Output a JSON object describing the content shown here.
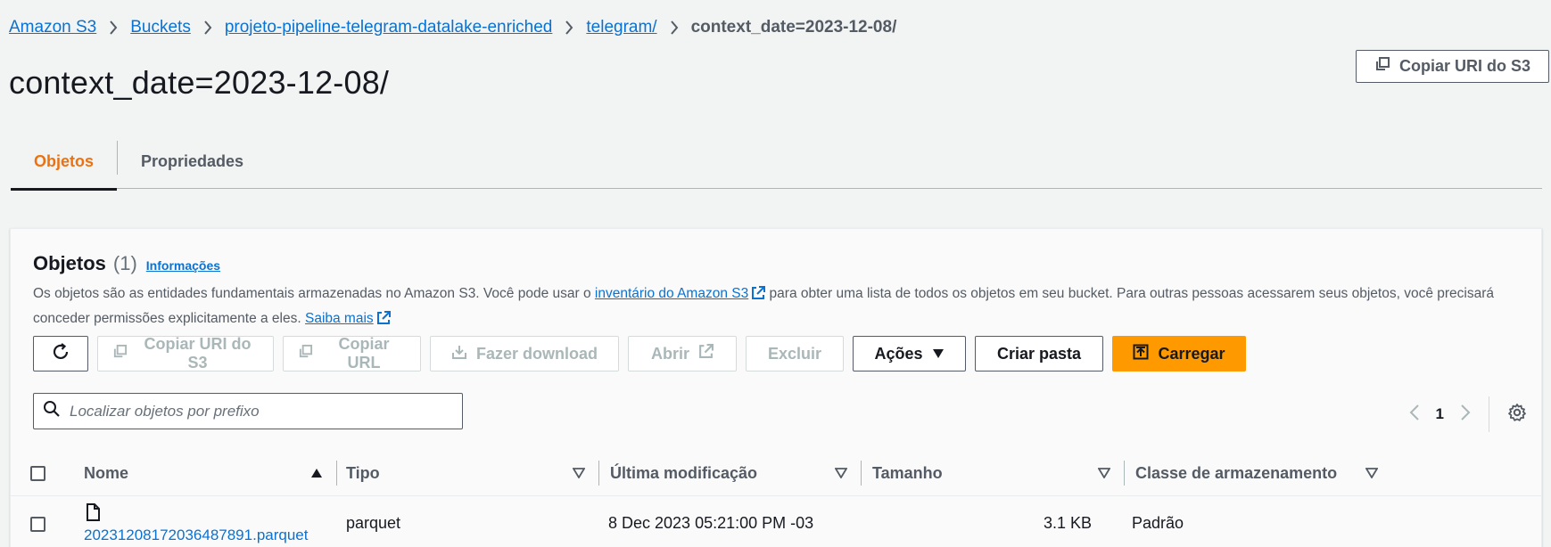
{
  "breadcrumb": {
    "items": [
      "Amazon S3",
      "Buckets",
      "projeto-pipeline-telegram-datalake-enriched",
      "telegram/"
    ],
    "current": "context_date=2023-12-08/"
  },
  "page": {
    "title": "context_date=2023-12-08/",
    "copy_uri_label": "Copiar URI do S3"
  },
  "tabs": [
    {
      "label": "Objetos",
      "active": true
    },
    {
      "label": "Propriedades",
      "active": false
    }
  ],
  "objects_panel": {
    "title": "Objetos",
    "count": "(1)",
    "info_link": "Informações",
    "desc_part1": "Os objetos são as entidades fundamentais armazenadas no Amazon S3. Você pode usar o ",
    "desc_link1": "inventário do Amazon S3",
    "desc_part2": " para obter uma lista de todos os objetos em seu bucket. Para outras pessoas acessarem seus objetos, você precisará conceder permissões explicitamente a eles. ",
    "desc_link2": "Saiba mais"
  },
  "toolbar": {
    "refresh_icon": "refresh-icon",
    "copy_uri": "Copiar URI do S3",
    "copy_url": "Copiar URL",
    "download": "Fazer download",
    "open": "Abrir",
    "delete": "Excluir",
    "actions": "Ações",
    "create_folder": "Criar pasta",
    "upload": "Carregar"
  },
  "search": {
    "placeholder": "Localizar objetos por prefixo",
    "value": ""
  },
  "pagination": {
    "current_page": "1"
  },
  "table": {
    "columns": [
      "Nome",
      "Tipo",
      "Última modificação",
      "Tamanho",
      "Classe de armazenamento"
    ],
    "rows": [
      {
        "name": "20231208172036487891.parquet",
        "type": "parquet",
        "modified": "8 Dec 2023 05:21:00 PM -03",
        "size": "3.1 KB",
        "storage_class": "Padrão"
      }
    ]
  },
  "colors": {
    "accent_orange": "#ff9900",
    "tab_active": "#ec7211",
    "link_blue": "#0972d3"
  }
}
